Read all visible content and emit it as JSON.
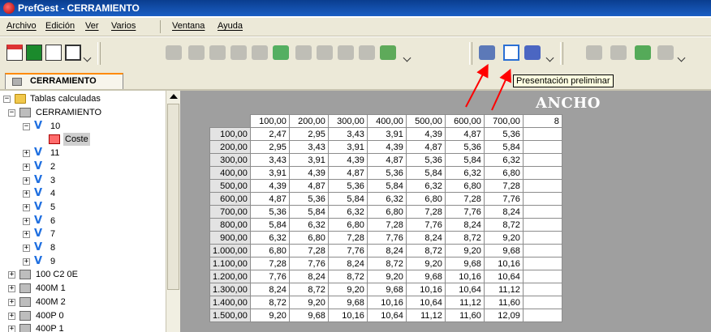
{
  "window": {
    "title": "PrefGest - CERRAMIENTO"
  },
  "menu": [
    {
      "label": "Archivo"
    },
    {
      "label": "Edición"
    },
    {
      "label": "Ver"
    },
    {
      "label": "Varios"
    },
    {
      "label": "Ventana"
    },
    {
      "label": "Ayuda"
    }
  ],
  "document_tab": {
    "label": "CERRAMIENTO"
  },
  "tooltip": {
    "text": "Presentación preliminar"
  },
  "tree": {
    "root": "Tablas calculadas",
    "nodes": [
      {
        "label": "CERRAMIENTO",
        "level": 1,
        "icon": "grid-icon",
        "expander": "−"
      },
      {
        "label": "10",
        "level": 2,
        "icon": "v-icon",
        "expander": "−"
      },
      {
        "label": "Coste",
        "level": 3,
        "icon": "cost-table-icon",
        "expander": ""
      },
      {
        "label": "11",
        "level": 2,
        "icon": "v-icon",
        "expander": "+"
      },
      {
        "label": "2",
        "level": 2,
        "icon": "v-icon",
        "expander": "+"
      },
      {
        "label": "3",
        "level": 2,
        "icon": "v-icon",
        "expander": "+"
      },
      {
        "label": "4",
        "level": 2,
        "icon": "v-icon",
        "expander": "+"
      },
      {
        "label": "5",
        "level": 2,
        "icon": "v-icon",
        "expander": "+"
      },
      {
        "label": "6",
        "level": 2,
        "icon": "v-icon",
        "expander": "+"
      },
      {
        "label": "7",
        "level": 2,
        "icon": "v-icon",
        "expander": "+"
      },
      {
        "label": "8",
        "level": 2,
        "icon": "v-icon",
        "expander": "+"
      },
      {
        "label": "9",
        "level": 2,
        "icon": "v-icon",
        "expander": "+"
      },
      {
        "label": "100 C2 0E",
        "level": 1,
        "icon": "grid-icon",
        "expander": "+"
      },
      {
        "label": "400M 1",
        "level": 1,
        "icon": "grid-icon",
        "expander": "+"
      },
      {
        "label": "400M 2",
        "level": 1,
        "icon": "grid-icon",
        "expander": "+"
      },
      {
        "label": "400P 0",
        "level": 1,
        "icon": "grid-icon",
        "expander": "+"
      },
      {
        "label": "400P 1",
        "level": 1,
        "icon": "grid-icon",
        "expander": "+"
      }
    ]
  },
  "table": {
    "caption": "ANCHO",
    "columns": [
      "100,00",
      "200,00",
      "300,00",
      "400,00",
      "500,00",
      "600,00",
      "700,00",
      "8"
    ],
    "rows": [
      {
        "label": "100,00",
        "values": [
          "2,47",
          "2,95",
          "3,43",
          "3,91",
          "4,39",
          "4,87",
          "5,36"
        ]
      },
      {
        "label": "200,00",
        "values": [
          "2,95",
          "3,43",
          "3,91",
          "4,39",
          "4,87",
          "5,36",
          "5,84"
        ]
      },
      {
        "label": "300,00",
        "values": [
          "3,43",
          "3,91",
          "4,39",
          "4,87",
          "5,36",
          "5,84",
          "6,32"
        ]
      },
      {
        "label": "400,00",
        "values": [
          "3,91",
          "4,39",
          "4,87",
          "5,36",
          "5,84",
          "6,32",
          "6,80"
        ]
      },
      {
        "label": "500,00",
        "values": [
          "4,39",
          "4,87",
          "5,36",
          "5,84",
          "6,32",
          "6,80",
          "7,28"
        ]
      },
      {
        "label": "600,00",
        "values": [
          "4,87",
          "5,36",
          "5,84",
          "6,32",
          "6,80",
          "7,28",
          "7,76"
        ]
      },
      {
        "label": "700,00",
        "values": [
          "5,36",
          "5,84",
          "6,32",
          "6,80",
          "7,28",
          "7,76",
          "8,24"
        ]
      },
      {
        "label": "800,00",
        "values": [
          "5,84",
          "6,32",
          "6,80",
          "7,28",
          "7,76",
          "8,24",
          "8,72"
        ]
      },
      {
        "label": "900,00",
        "values": [
          "6,32",
          "6,80",
          "7,28",
          "7,76",
          "8,24",
          "8,72",
          "9,20"
        ]
      },
      {
        "label": "1.000,00",
        "values": [
          "6,80",
          "7,28",
          "7,76",
          "8,24",
          "8,72",
          "9,20",
          "9,68"
        ]
      },
      {
        "label": "1.100,00",
        "values": [
          "7,28",
          "7,76",
          "8,24",
          "8,72",
          "9,20",
          "9,68",
          "10,16"
        ]
      },
      {
        "label": "1.200,00",
        "values": [
          "7,76",
          "8,24",
          "8,72",
          "9,20",
          "9,68",
          "10,16",
          "10,64"
        ]
      },
      {
        "label": "1.300,00",
        "values": [
          "8,24",
          "8,72",
          "9,20",
          "9,68",
          "10,16",
          "10,64",
          "11,12"
        ]
      },
      {
        "label": "1.400,00",
        "values": [
          "8,72",
          "9,20",
          "9,68",
          "10,16",
          "10,64",
          "11,12",
          "11,60"
        ]
      },
      {
        "label": "1.500,00",
        "values": [
          "9,20",
          "9,68",
          "10,16",
          "10,64",
          "11,12",
          "11,60",
          "12,09"
        ]
      }
    ]
  },
  "colors": {
    "title_bar": "#0a3d8f",
    "arrow": "#ff0000",
    "tooltip_bg": "#ffffe1",
    "grid_bg": "#9f9f9f"
  }
}
